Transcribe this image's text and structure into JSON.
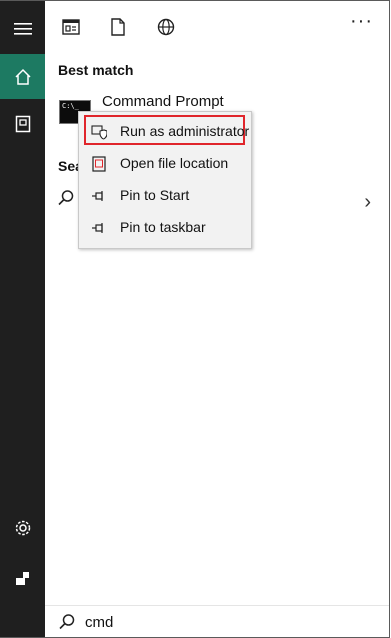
{
  "sidebar": {
    "items": [
      {
        "icon": "hamburger-menu-icon"
      },
      {
        "icon": "home-icon",
        "active": true
      },
      {
        "icon": "documents-icon"
      },
      {
        "icon": "settings-gear-icon"
      },
      {
        "icon": "account-icon"
      }
    ]
  },
  "topbar": {
    "icons": [
      "apps-icon",
      "document-icon",
      "web-icon"
    ],
    "more_label": "···"
  },
  "best_match": {
    "heading": "Best match",
    "result_label": "Command Prompt",
    "result_icon_text": "C:\\_"
  },
  "search_section": {
    "heading": "Sea"
  },
  "context_menu": {
    "items": [
      {
        "label": "Run as administrator",
        "icon": "shield-admin-icon",
        "highlighted": true
      },
      {
        "label": "Open file location",
        "icon": "file-location-icon"
      },
      {
        "label": "Pin to Start",
        "icon": "pin-icon"
      },
      {
        "label": "Pin to taskbar",
        "icon": "pin-icon"
      }
    ]
  },
  "search_box": {
    "value": "cmd"
  },
  "colors": {
    "rail": "#1f1f1f",
    "accent": "#1d7a62",
    "highlight": "#e0252b"
  }
}
